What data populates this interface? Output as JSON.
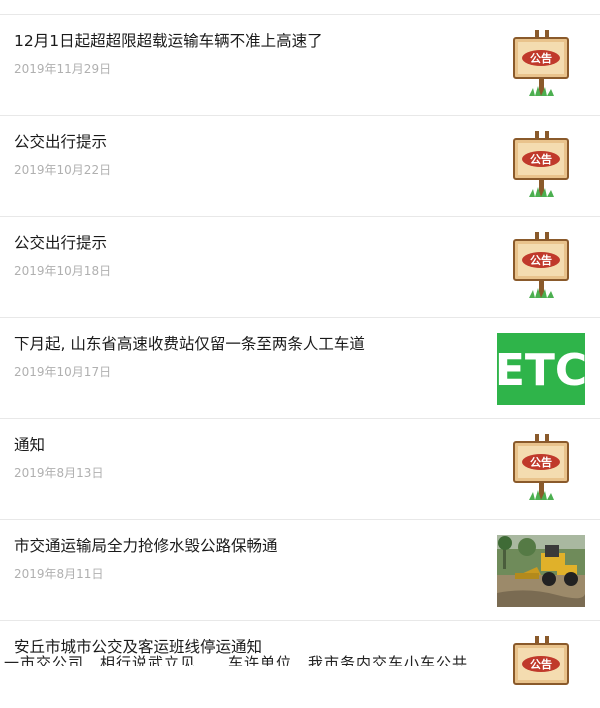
{
  "news": {
    "items": [
      {
        "title": "12月1日起超超限超载运输车辆不准上高速了",
        "date": "2019年11月29日",
        "thumb": "notice-board",
        "notice_text": "公告"
      },
      {
        "title": "公交出行提示",
        "date": "2019年10月22日",
        "thumb": "notice-board",
        "notice_text": "公告"
      },
      {
        "title": "公交出行提示",
        "date": "2019年10月18日",
        "thumb": "notice-board",
        "notice_text": "公告"
      },
      {
        "title": "下月起, 山东省高速收费站仅留一条至两条人工车道",
        "date": "2019年10月17日",
        "thumb": "etc-sign",
        "etc_text": "ETC"
      },
      {
        "title": "通知",
        "date": "2019年8月13日",
        "thumb": "notice-board",
        "notice_text": "公告"
      },
      {
        "title": "市交通运输局全力抢修水毁公路保畅通",
        "date": "2019年8月11日",
        "thumb": "construction-photo"
      },
      {
        "title": "安丘市城市公交及客运班线停运通知",
        "date": "",
        "thumb": "notice-board",
        "notice_text": "公告"
      }
    ]
  },
  "overlay_text": "一市交公司…相行说武立见……车许单位…我市务内交车小车公共",
  "colors": {
    "title": "#1a1a1a",
    "date": "#b0b0b0",
    "divider": "#e8e8e8",
    "etc_green": "#2fb44a",
    "notice_red": "#c0392b"
  }
}
